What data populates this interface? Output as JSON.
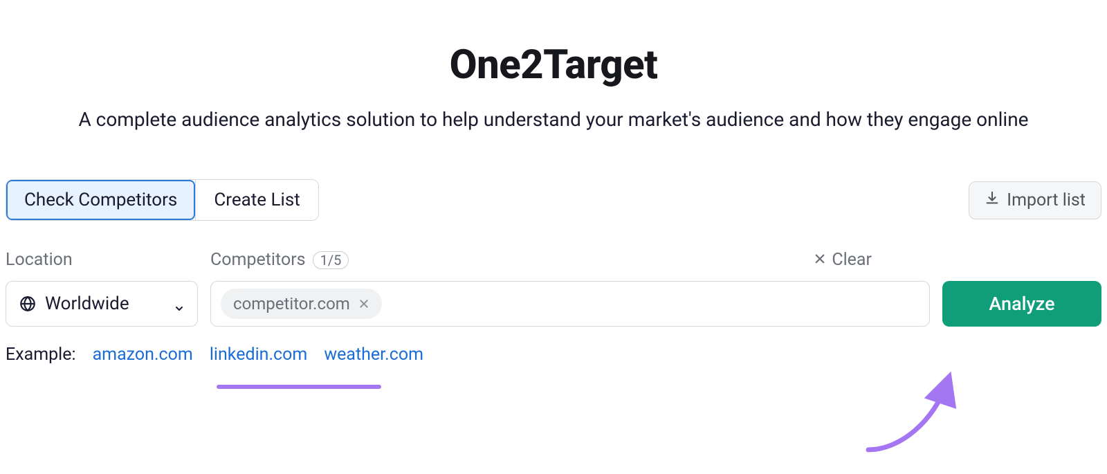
{
  "title": "One2Target",
  "subtitle": "A complete audience analytics solution to help understand your market's audience and how they engage online",
  "tabs": {
    "check": "Check Competitors",
    "create": "Create List"
  },
  "import_label": "Import list",
  "labels": {
    "location": "Location",
    "competitors": "Competitors",
    "count": "1/5",
    "clear": "Clear"
  },
  "location": {
    "value": "Worldwide"
  },
  "token": {
    "value": "competitor.com"
  },
  "analyze_label": "Analyze",
  "examples": {
    "label": "Example:",
    "items": [
      "amazon.com",
      "linkedin.com",
      "weather.com"
    ]
  }
}
